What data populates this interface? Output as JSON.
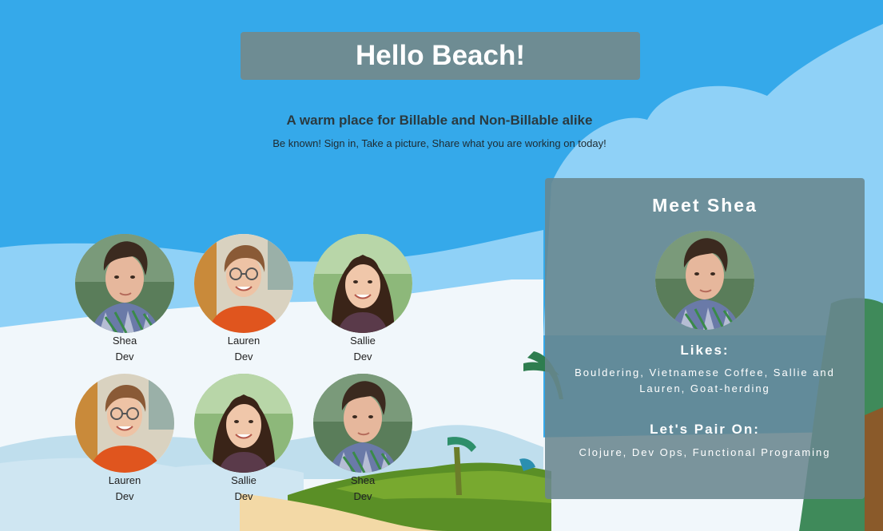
{
  "header": {
    "title": "Hello Beach!"
  },
  "intro": {
    "tagline": "A warm place for Billable and Non-Billable alike",
    "subline": "Be known! Sign in, Take a picture, Share what you are working on today!"
  },
  "people": [
    {
      "name": "Shea",
      "role": "Dev",
      "avatar": "shea"
    },
    {
      "name": "Lauren",
      "role": "Dev",
      "avatar": "lauren"
    },
    {
      "name": "Sallie",
      "role": "Dev",
      "avatar": "sallie"
    },
    {
      "name": "Lauren",
      "role": "Dev",
      "avatar": "lauren"
    },
    {
      "name": "Sallie",
      "role": "Dev",
      "avatar": "sallie"
    },
    {
      "name": "Shea",
      "role": "Dev",
      "avatar": "shea"
    }
  ],
  "profile": {
    "title": "Meet Shea",
    "likes_heading": "Likes:",
    "likes": "Bouldering, Vietnamese Coffee, Sallie and Lauren, Goat-herding",
    "pair_heading": "Let's Pair On:",
    "pair": "Clojure, Dev Ops, Functional Programing"
  }
}
